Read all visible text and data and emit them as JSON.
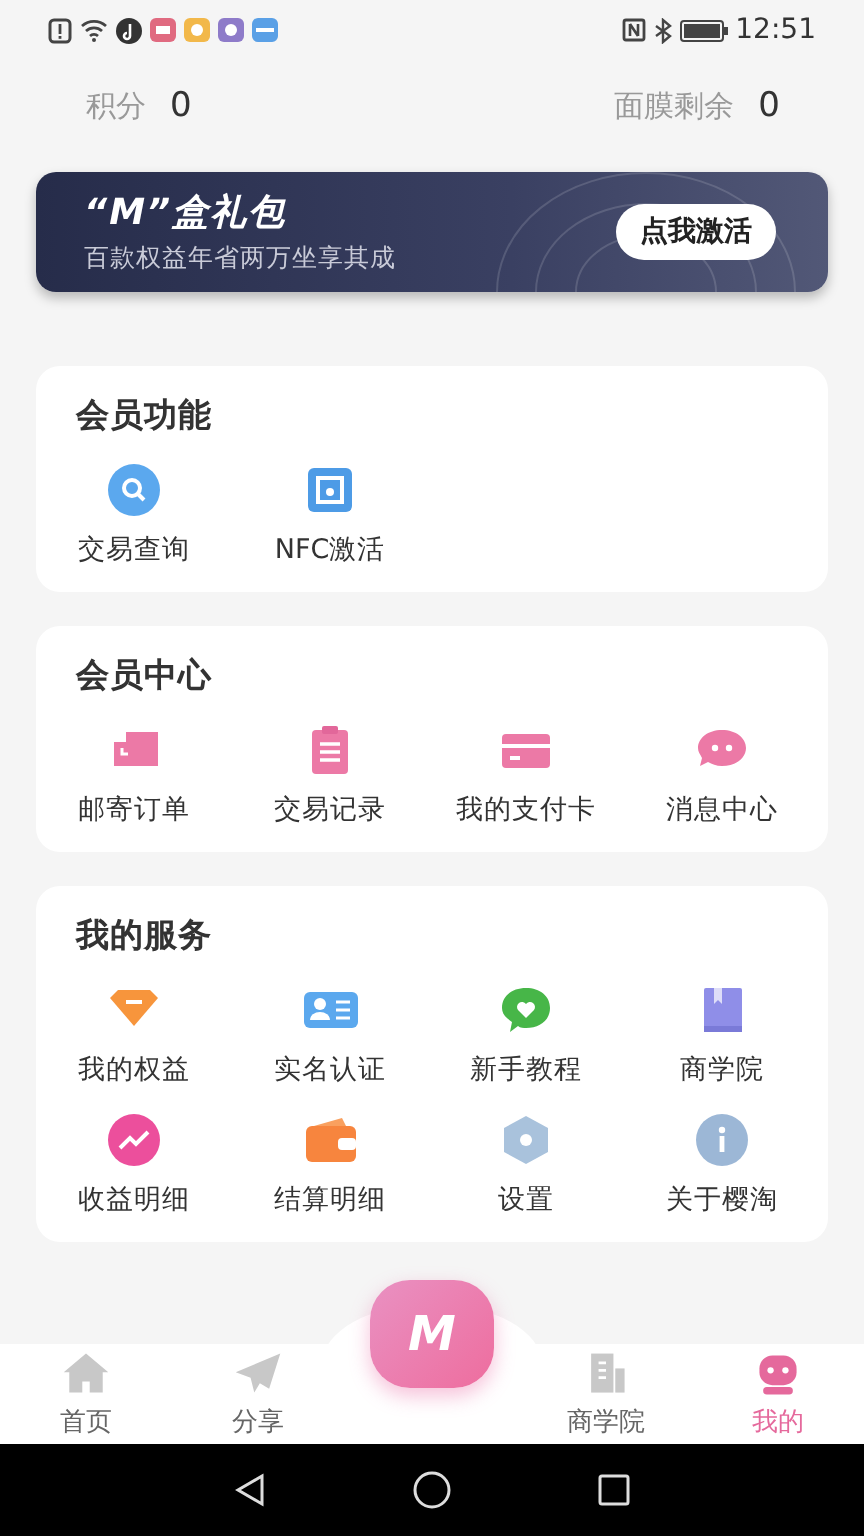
{
  "status_bar": {
    "time": "12:51"
  },
  "stats": [
    {
      "label": "积分",
      "value": "0"
    },
    {
      "label": "面膜剩余",
      "value": "0"
    }
  ],
  "banner": {
    "title": "“M”盒礼包",
    "subtitle": "百款权益年省两万坐享其成",
    "button": "点我激活"
  },
  "sections": [
    {
      "title": "会员功能",
      "items": [
        {
          "label": "交易查询"
        },
        {
          "label": "NFC激活"
        }
      ]
    },
    {
      "title": "会员中心",
      "items": [
        {
          "label": "邮寄订单"
        },
        {
          "label": "交易记录"
        },
        {
          "label": "我的支付卡"
        },
        {
          "label": "消息中心"
        }
      ]
    },
    {
      "title": "我的服务",
      "items": [
        {
          "label": "我的权益"
        },
        {
          "label": "实名认证"
        },
        {
          "label": "新手教程"
        },
        {
          "label": "商学院"
        },
        {
          "label": "收益明细"
        },
        {
          "label": "结算明细"
        },
        {
          "label": "设置"
        },
        {
          "label": "关于樱淘"
        }
      ]
    }
  ],
  "center_button": {
    "label": "M"
  },
  "tabs": [
    {
      "label": "首页",
      "selected": false
    },
    {
      "label": "分享",
      "selected": false
    },
    {
      "label": "商学院",
      "selected": false
    },
    {
      "label": "我的",
      "selected": true
    }
  ]
}
